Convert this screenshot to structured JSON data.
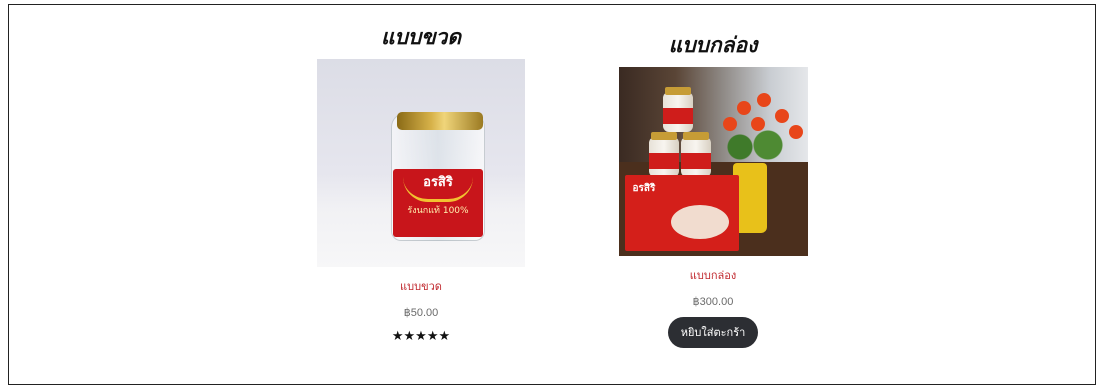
{
  "products": [
    {
      "heading": "แบบขวด",
      "image_alt": "แบบขวด",
      "jar_brand": "อรสิริ",
      "jar_sub": "รังนกแท้ 100%",
      "title": "แบบขวด",
      "price": "฿50.00",
      "rating_stars": "★★★★★",
      "rating_value": 5,
      "rating_max": 5
    },
    {
      "heading": "แบบกล่อง",
      "image_alt": "แบบกล่อง",
      "box_brand": "อรสิริ",
      "title": "แบบกล่อง",
      "price": "฿300.00",
      "cart_button_label": "หยิบใส่ตะกร้า"
    }
  ],
  "colors": {
    "title_link": "#c0272d",
    "price_text": "#6b6b6b",
    "cart_button_bg": "#2c2e33",
    "cart_button_text": "#ffffff"
  }
}
